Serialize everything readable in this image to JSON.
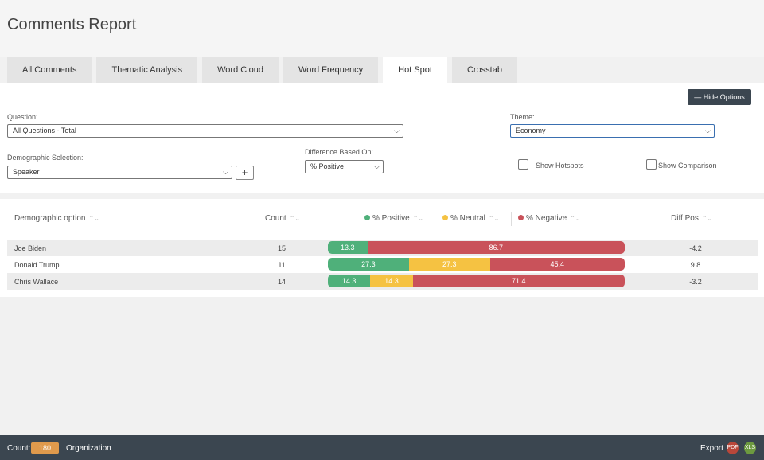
{
  "title": "Comments Report",
  "tabs": [
    "All Comments",
    "Thematic Analysis",
    "Word Cloud",
    "Word Frequency",
    "Hot Spot",
    "Crosstab"
  ],
  "active_tab": "Hot Spot",
  "options": {
    "hide_options": "Hide Options",
    "question_label": "Question:",
    "question_value": "All Questions - Total",
    "theme_label": "Theme:",
    "theme_value": "Economy",
    "demographic_label": "Demographic Selection:",
    "demographic_value": "Speaker",
    "difference_label": "Difference Based On:",
    "difference_value": "% Positive",
    "show_hotspots": "Show Hotspots",
    "show_comparison": "Show Comparison"
  },
  "table": {
    "headers": {
      "demographic": "Demographic option",
      "count": "Count",
      "positive": "% Positive",
      "neutral": "% Neutral",
      "negative": "% Negative",
      "diff": "Diff Pos"
    },
    "rows": [
      {
        "name": "Joe Biden",
        "count": "15",
        "positive": 13.3,
        "neutral": 0,
        "negative": 86.7,
        "positive_label": "13.3",
        "neutral_label": "",
        "negative_label": "86.7",
        "diff": "-4.2"
      },
      {
        "name": "Donald Trump",
        "count": "11",
        "positive": 27.3,
        "neutral": 27.3,
        "negative": 45.4,
        "positive_label": "27.3",
        "neutral_label": "27.3",
        "negative_label": "45.4",
        "diff": "9.8"
      },
      {
        "name": "Chris Wallace",
        "count": "14",
        "positive": 14.3,
        "neutral": 14.3,
        "negative": 71.4,
        "positive_label": "14.3",
        "neutral_label": "14.3",
        "negative_label": "71.4",
        "diff": "-3.2"
      }
    ]
  },
  "colors": {
    "positive": "#4fb07a",
    "neutral": "#f5c242",
    "negative": "#c9525a",
    "footer": "#3b4650",
    "badge": "#e09a4c"
  },
  "footer": {
    "count_label": "Count:",
    "count_value": "180",
    "organization": "Organization",
    "export": "Export",
    "pdf_icon": "PDF",
    "xls_icon": "XLS"
  }
}
